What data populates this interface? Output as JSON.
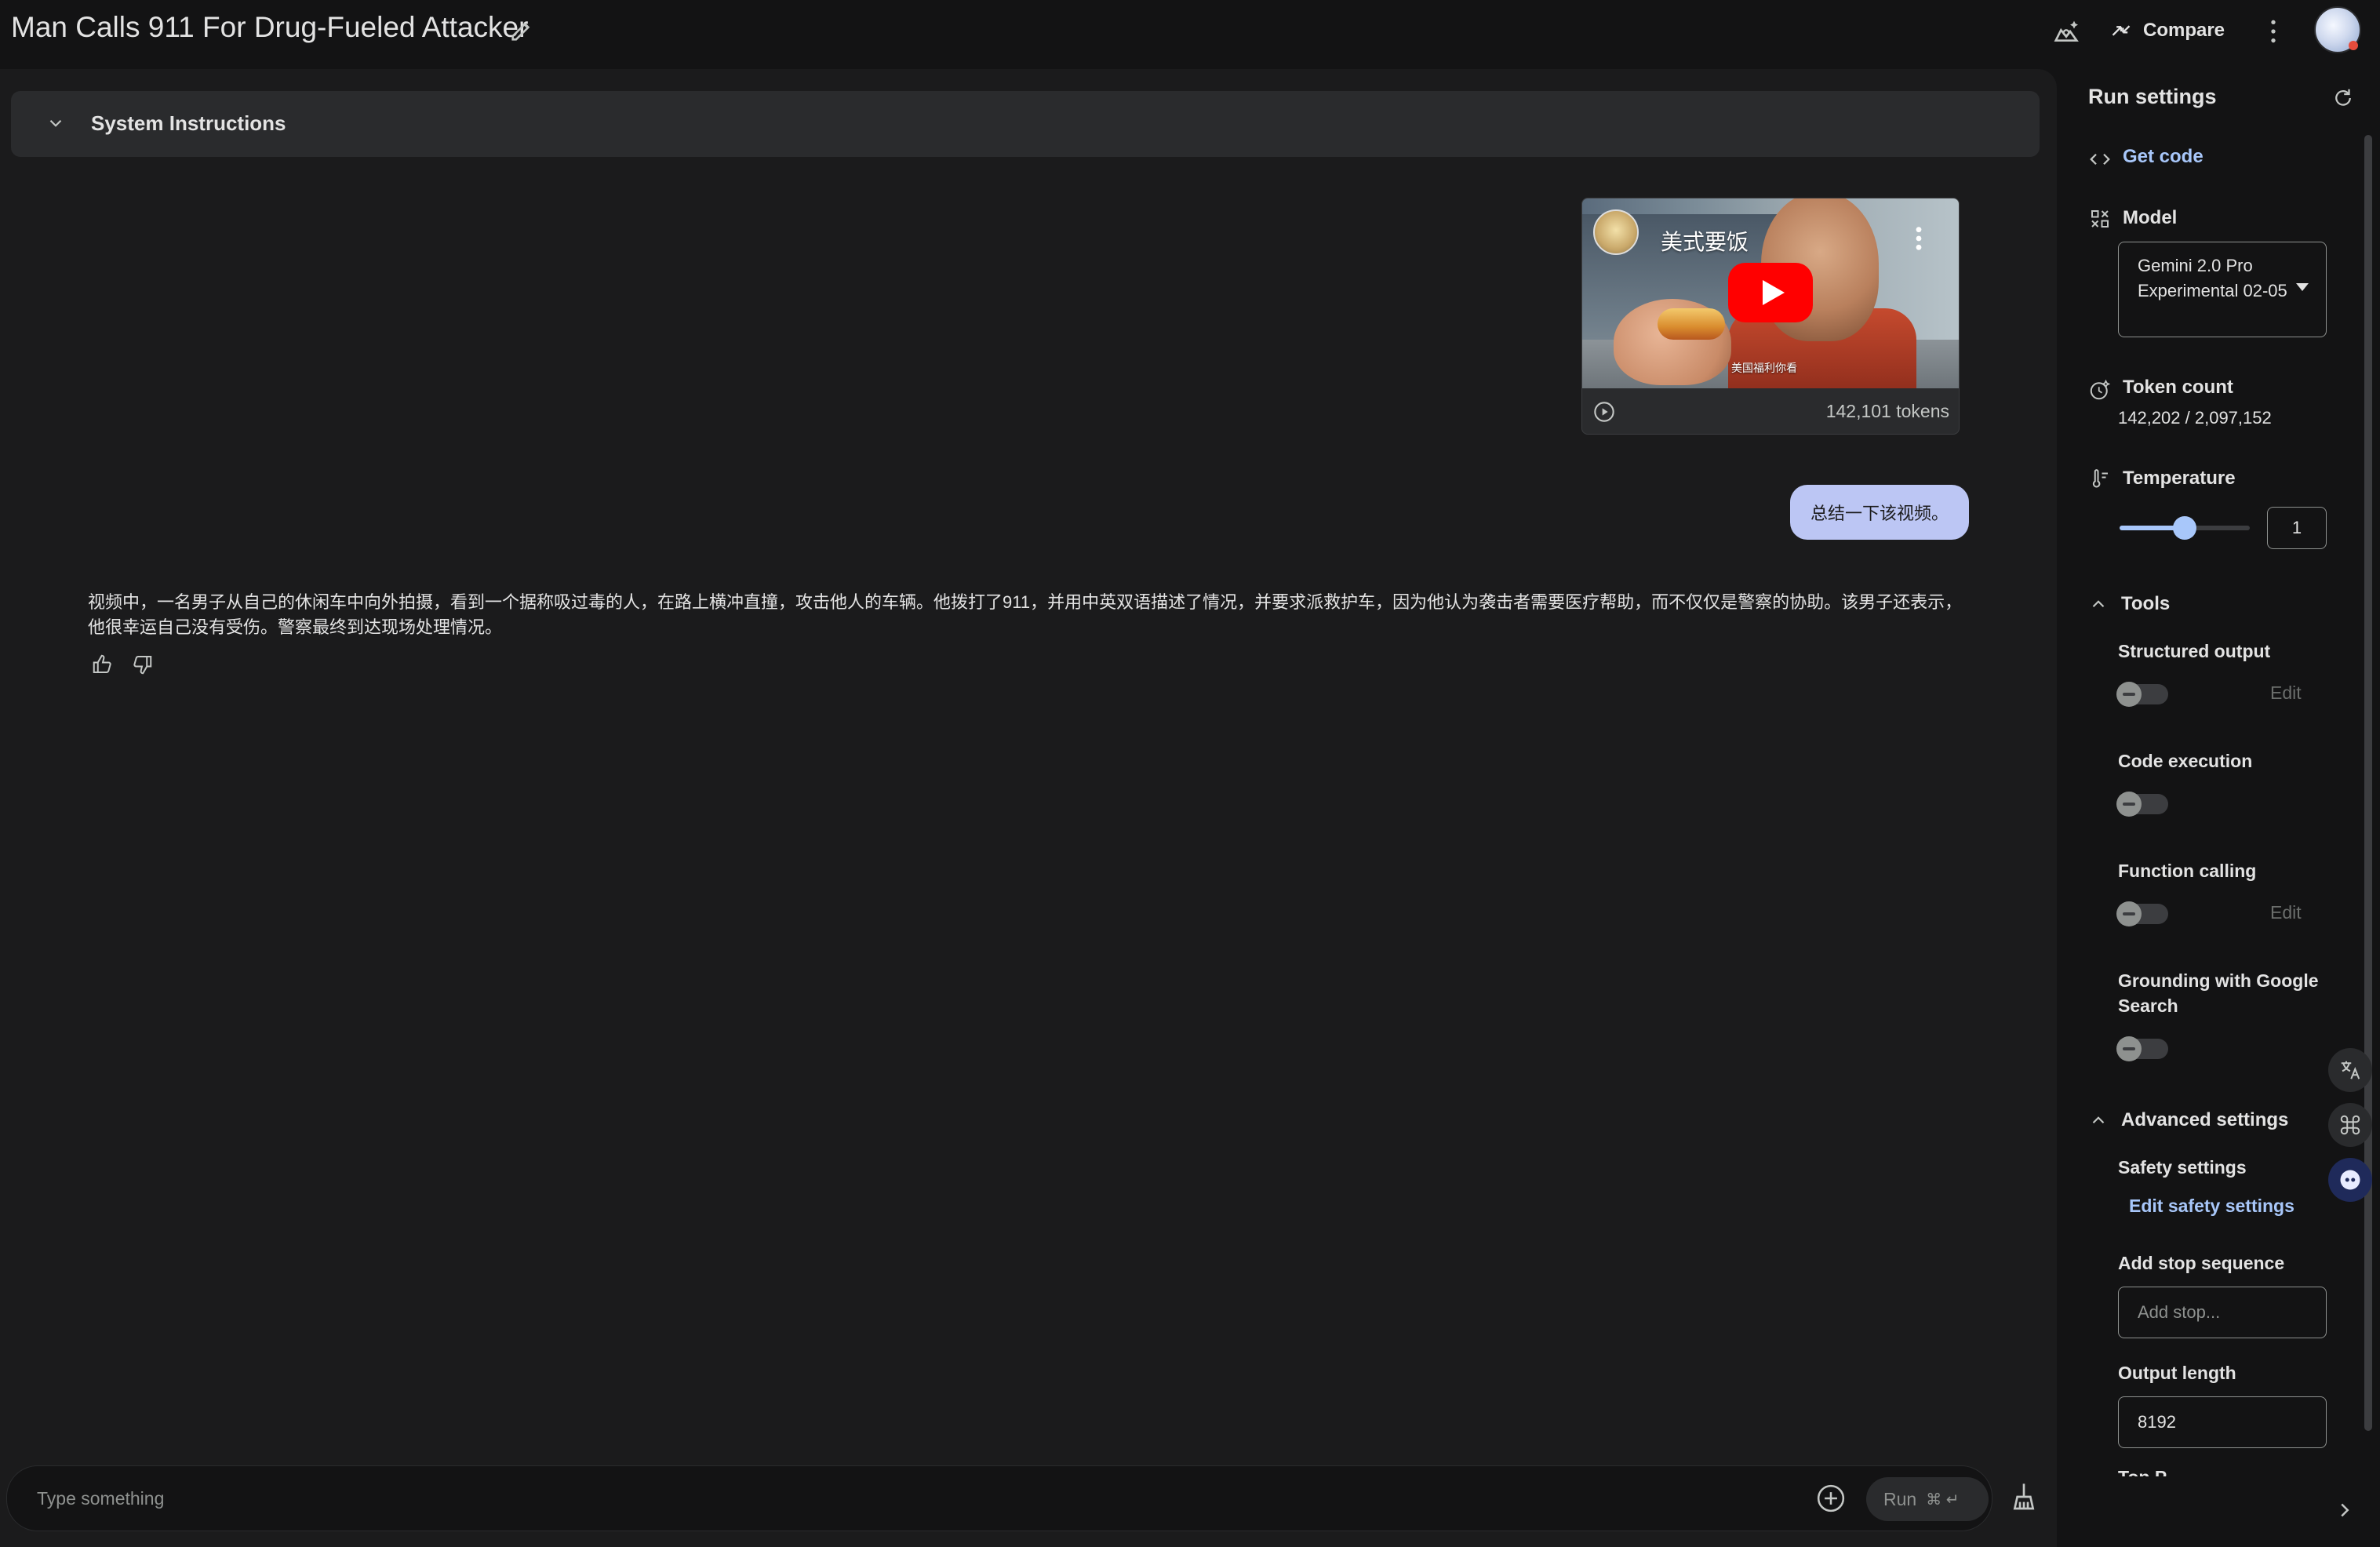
{
  "header": {
    "title": "Man Calls 911 For Drug-Fueled Attacker",
    "compare_label": "Compare"
  },
  "system_instructions": {
    "label": "System Instructions"
  },
  "video": {
    "channel_name": "美式要饭",
    "subtitle": "美国福利你看",
    "tokens": "142,101 tokens"
  },
  "user_message": "总结一下该视频。",
  "model_response": "视频中，一名男子从自己的休闲车中向外拍摄，看到一个据称吸过毒的人，在路上横冲直撞，攻击他人的车辆。他拨打了911，并用中英双语描述了情况，并要求派救护车，因为他认为袭击者需要医疗帮助，而不仅仅是警察的协助。该男子还表示，他很幸运自己没有受伤。警察最终到达现场处理情况。",
  "input": {
    "placeholder": "Type something",
    "run_label": "Run",
    "run_shortcut": "⌘ ↵"
  },
  "run_settings": {
    "title": "Run settings",
    "get_code": "Get code",
    "model_label": "Model",
    "model_value": "Gemini 2.0 Pro Experimental 02-05",
    "token_count_label": "Token count",
    "token_count_value": "142,202 / 2,097,152",
    "temperature_label": "Temperature",
    "temperature_value": "1",
    "temperature_fraction": 0.5,
    "tools_label": "Tools",
    "structured_output_label": "Structured output",
    "code_execution_label": "Code execution",
    "function_calling_label": "Function calling",
    "grounding_label": "Grounding with Google Search",
    "edit_label": "Edit",
    "advanced_label": "Advanced settings",
    "safety_label": "Safety settings",
    "edit_safety_label": "Edit safety settings",
    "stop_seq_label": "Add stop sequence",
    "stop_seq_placeholder": "Add stop...",
    "output_length_label": "Output length",
    "output_length_value": "8192",
    "top_p_label": "Top P"
  }
}
